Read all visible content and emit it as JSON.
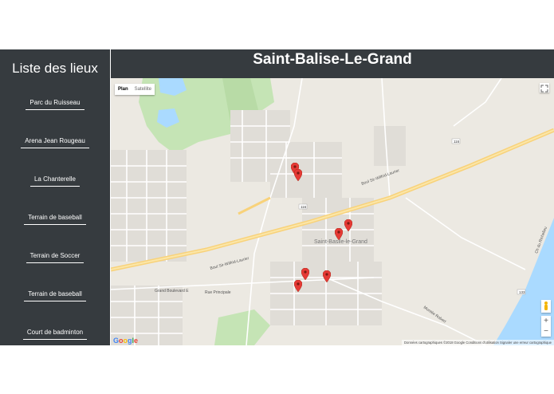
{
  "sidebar": {
    "title": "Liste des lieux",
    "places": [
      "Parc du Ruisseau",
      "Arena Jean Rougeau",
      "La Chanterelle",
      "Terrain de baseball",
      "Terrain de Soccer",
      "Terrain de baseball",
      "Court de badminton"
    ]
  },
  "header": {
    "title": "Saint-Balise-Le-Grand"
  },
  "map": {
    "type_plan": "Plan",
    "type_satellite": "Satellite",
    "town_label": "Saint-Basile-le-Grand",
    "road_main": "Boul Sir-Wilfrid-Laurier",
    "road_main_west": "Boul Sir-Wilfrid-Laurier",
    "road_grand": "Grand Boulevard E",
    "road_principale": "Rue Principale",
    "route_116": "116",
    "route_133": "133",
    "road_river": "Ch du Richelieu",
    "road_montarville": "Montée Robert",
    "zoom_in": "+",
    "zoom_out": "−",
    "google": "Google",
    "attribution": "Données cartographiques ©2018 Google   Conditions d'utilisation   Signaler une erreur cartographique",
    "pin_color": "#e53935"
  }
}
